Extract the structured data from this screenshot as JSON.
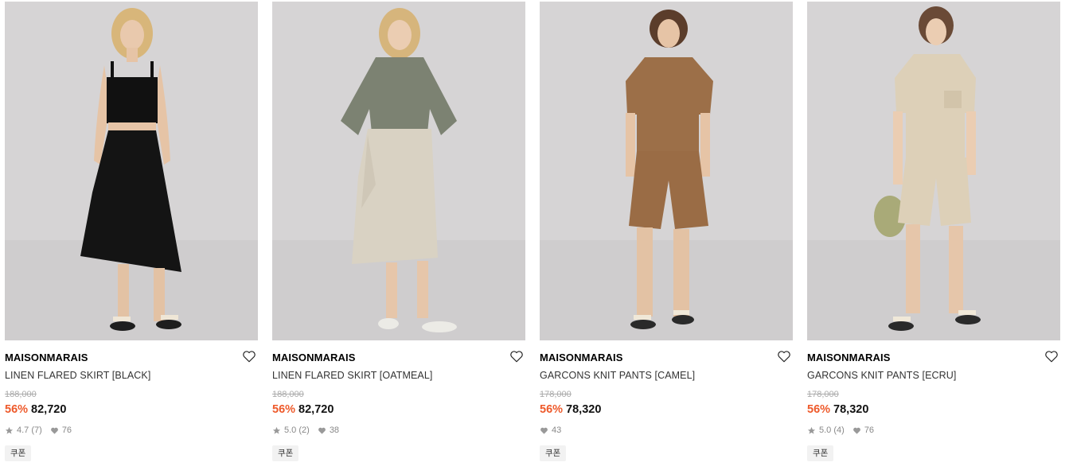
{
  "products": [
    {
      "brand": "MAISONMARAIS",
      "name": "LINEN FLARED SKIRT [BLACK]",
      "original_price": "188,000",
      "discount": "56%",
      "price": "82,720",
      "rating": "4.7",
      "reviews": "(7)",
      "likes": "76",
      "coupon": "쿠폰",
      "colors": {
        "top": "#111111",
        "bottom": "#141414"
      }
    },
    {
      "brand": "MAISONMARAIS",
      "name": "LINEN FLARED SKIRT [OATMEAL]",
      "original_price": "188,000",
      "discount": "56%",
      "price": "82,720",
      "rating": "5.0",
      "reviews": "(2)",
      "likes": "38",
      "coupon": "쿠폰",
      "colors": {
        "top": "#7c8272",
        "bottom": "#d9d2c3"
      }
    },
    {
      "brand": "MAISONMARAIS",
      "name": "GARCONS KNIT PANTS [CAMEL]",
      "original_price": "178,000",
      "discount": "56%",
      "price": "78,320",
      "rating": "",
      "reviews": "",
      "likes": "43",
      "coupon": "쿠폰",
      "colors": {
        "top": "#9c6f48",
        "bottom": "#9a6c45"
      }
    },
    {
      "brand": "MAISONMARAIS",
      "name": "GARCONS KNIT PANTS [ECRU]",
      "original_price": "178,000",
      "discount": "56%",
      "price": "78,320",
      "rating": "5.0",
      "reviews": "(4)",
      "likes": "76",
      "coupon": "쿠폰",
      "colors": {
        "top": "#ddd0b8",
        "bottom": "#ddd0b8"
      }
    }
  ],
  "theme": {
    "accent": "#ee5a2b",
    "photo_background": "#d6d4d5"
  }
}
